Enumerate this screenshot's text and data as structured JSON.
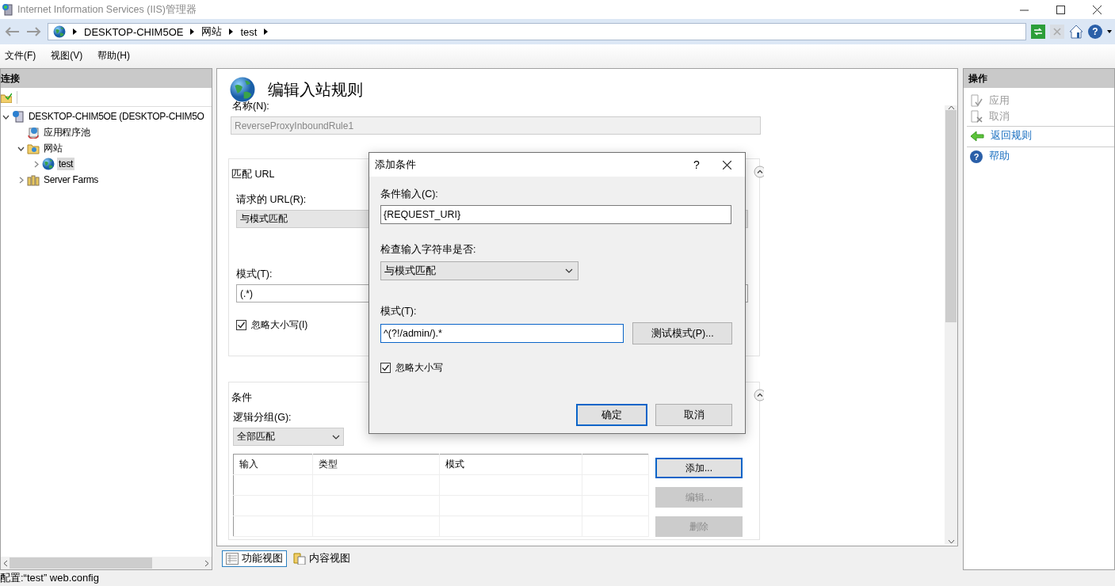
{
  "window": {
    "title": "Internet Information Services (IIS)管理器"
  },
  "address_bar": {
    "crumbs": [
      "DESKTOP-CHIM5OE",
      "网站",
      "test"
    ],
    "help_glyph": "?"
  },
  "menu": [
    "文件(F)",
    "视图(V)",
    "帮助(H)"
  ],
  "connections": {
    "title": "连接",
    "tree": [
      {
        "label": "DESKTOP-CHIM5OE (DESKTOP-CHIM5O",
        "kind": "server",
        "expanded": true,
        "selected": false,
        "children": [
          {
            "label": "应用程序池",
            "kind": "pool",
            "selected": false
          },
          {
            "label": "网站",
            "kind": "sites",
            "expanded": true,
            "selected": false,
            "children": [
              {
                "label": "test",
                "kind": "site",
                "expanded": false,
                "selected": true
              }
            ]
          },
          {
            "label": "Server Farms",
            "kind": "farms",
            "expanded": false,
            "selected": false
          }
        ]
      }
    ]
  },
  "rule_editor": {
    "title": "编辑入站规则",
    "name_label": "名称(N):",
    "name_value": "ReverseProxyInboundRule1",
    "match_url": {
      "heading": "匹配 URL",
      "requested_label": "请求的 URL(R):",
      "requested_value": "与模式匹配",
      "pattern_label": "模式(T):",
      "pattern_value": "(.*)",
      "ignore_case": {
        "label": "忽略大小写(I)",
        "checked": true
      }
    },
    "conditions": {
      "heading": "条件",
      "grouping_label": "逻辑分组(G):",
      "grouping_value": "全部匹配",
      "columns": [
        "输入",
        "类型",
        "模式"
      ],
      "buttons": [
        {
          "label": "添加...",
          "disabled": false
        },
        {
          "label": "编辑...",
          "disabled": true
        },
        {
          "label": "删除",
          "disabled": true
        }
      ]
    }
  },
  "view_tabs": [
    {
      "label": "功能视图",
      "selected": true
    },
    {
      "label": "内容视图",
      "selected": false
    }
  ],
  "actions": {
    "title": "操作",
    "items": [
      {
        "label": "应用",
        "kind": "apply",
        "disabled": true
      },
      {
        "label": "取消",
        "kind": "cancel",
        "disabled": true
      },
      {
        "label": "返回规则",
        "kind": "back",
        "disabled": false
      },
      {
        "label": "帮助",
        "kind": "help",
        "disabled": false,
        "glyph": "?"
      }
    ]
  },
  "dialog": {
    "title": "添加条件",
    "help": "?",
    "input_label": "条件输入(C):",
    "input_value": "{REQUEST_URI}",
    "check_label": "检查输入字符串是否:",
    "check_value": "与模式匹配",
    "pattern_label": "模式(T):",
    "pattern_value": "^(?!/admin/).*",
    "test_button": "测试模式(P)...",
    "ignore_case": {
      "label": "忽略大小写",
      "checked": true
    },
    "ok": "确定",
    "cancel": "取消"
  },
  "status_bar": {
    "text": "配置:“test” web.config"
  }
}
